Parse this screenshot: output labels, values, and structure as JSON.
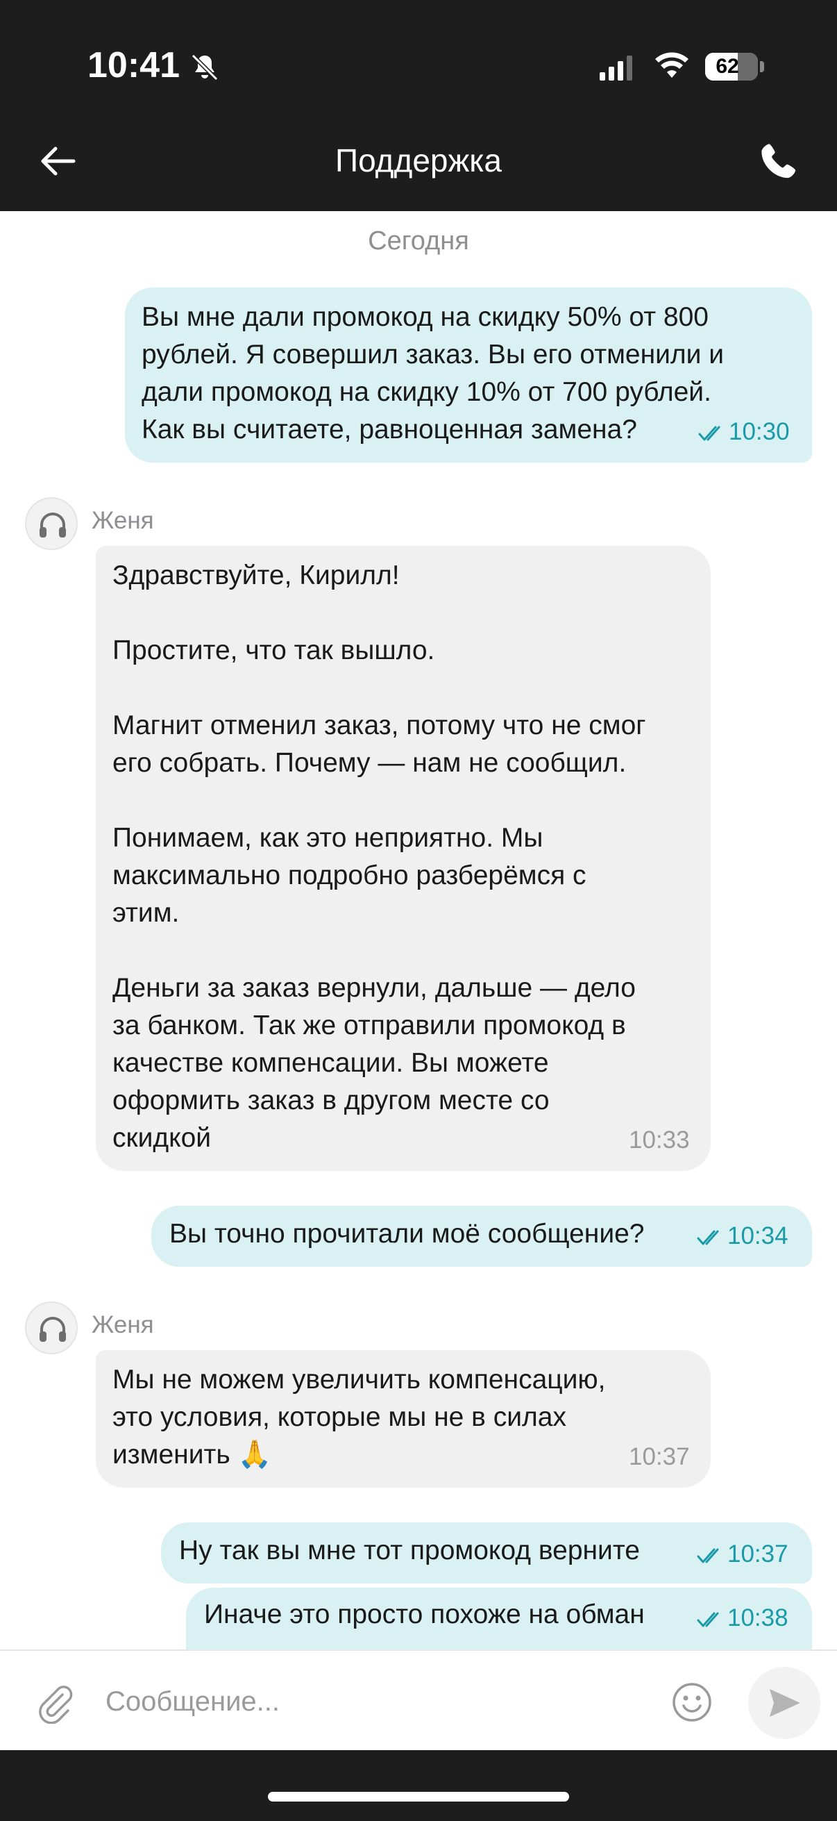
{
  "status_bar": {
    "time": "10:41",
    "battery": "62",
    "battery_level": 0.62
  },
  "header": {
    "title": "Поддержка",
    "back_icon": "arrow-left-icon",
    "call_icon": "phone-icon"
  },
  "chat": {
    "date_separator": "Сегодня",
    "messages": [
      {
        "direction": "out",
        "text": "Вы мне дали промокод на скидку 50% от 800\nрублей. Я совершил заказ. Вы его отменили и\nдали промокод на скидку 10% от 700 рублей.\nКак вы считаете, равноценная замена?",
        "time": "10:30",
        "read": true
      },
      {
        "direction": "in",
        "sender": "Женя",
        "text": "Здравствуйте, Кирилл!\n\nПростите, что так вышло.\n\nМагнит отменил заказ, потому что не смог\nего собрать. Почему — нам не сообщил.\n\nПонимаем, как это неприятно. Мы\nмаксимально подробно разберёмся с\nэтим.\n\nДеньги за заказ вернули, дальше — дело\nза банком. Так же отправили промокод в\nкачестве компенсации. Вы можете\nоформить заказ в другом месте со\nскидкой",
        "time": "10:33"
      },
      {
        "direction": "out",
        "text": "Вы точно прочитали моё сообщение?",
        "time": "10:34",
        "read": true
      },
      {
        "direction": "in",
        "sender": "Женя",
        "text": "Мы не можем увеличить компенсацию,\nэто условия, которые мы не в силах\nизменить 🙏",
        "time": "10:37"
      },
      {
        "direction": "out",
        "text": "Ну так вы мне тот промокод верните",
        "time": "10:37",
        "read": true
      },
      {
        "direction": "out",
        "text": "Иначе это просто похоже на обман",
        "time": "10:38",
        "read": true
      }
    ]
  },
  "composer": {
    "placeholder": "Сообщение...",
    "attach_icon": "paperclip-icon",
    "emoji_icon": "smile-icon",
    "send_icon": "send-icon"
  },
  "colors": {
    "header_bg": "#1d1d1d",
    "outgoing_bubble": "#d9f1f3",
    "incoming_bubble": "#f0f0f0",
    "read_tick": "#1a9aa8"
  }
}
